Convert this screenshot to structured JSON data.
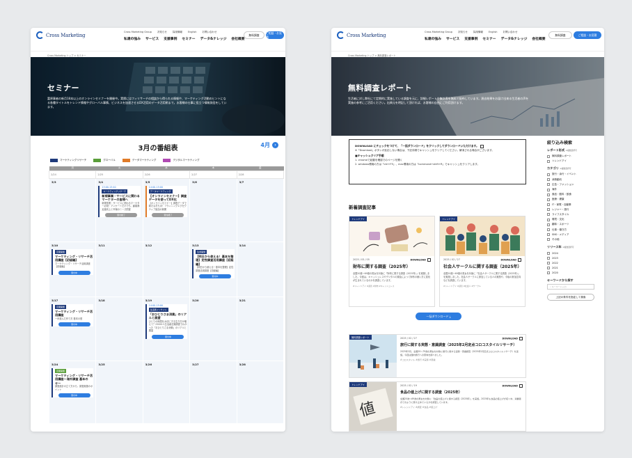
{
  "brand": {
    "logo": "Cross Marketing",
    "primary": "#2e7de0",
    "navy": "#1e3a7b"
  },
  "header": {
    "util": [
      "Cross Marketing Group",
      "お知らせ",
      "採用情報",
      "English",
      "お問い合わせ"
    ],
    "nav": [
      "私達の強み",
      "サービス",
      "支援事例",
      "セミナー",
      "データ&ナレッジ",
      "会社概要"
    ],
    "btn_free": "無料調査",
    "btn_contact": "ご相談・お見積"
  },
  "seminar": {
    "breadcrumb": "Cross Marketing トップ > セミナー",
    "hero_title": "セミナー",
    "hero_text": "富原事者の新月18本以上のオンラインセミナーを開催中。実際にはフィリサーチの相談から得られる情報や、マーケティング活動のヒントになる各種タイトルをトレンド情報やグローバル事情、ビジネスを加速させるDX活用のデータ活用術まで。お客様の仕事に役立つ情報発信をしています。",
    "month_title": "3月の番組表",
    "next_month": "4月",
    "legend": [
      {
        "label": "マーケティングリサーチ",
        "color": "#1e3a7b"
      },
      {
        "label": "グローバル",
        "color": "#5a9e3a"
      },
      {
        "label": "データマーケティング",
        "color": "#e07b28"
      },
      {
        "label": "デジタルマーケティング",
        "color": "#b04ab3"
      }
    ],
    "weekdays": [
      "月",
      "火",
      "水",
      "木",
      "金"
    ],
    "weeks": [
      {
        "labels": [
          "2/24",
          "2/25",
          "2/26",
          "2/27",
          "2/28"
        ],
        "days": [
          "3/3",
          "3/4",
          "3/5",
          "3/6",
          "3/7"
        ]
      },
      {
        "labels": [],
        "days": [
          "3/10",
          "3/11",
          "3/12",
          "3/13",
          "3/14"
        ]
      },
      {
        "labels": [],
        "days": [
          "3/17",
          "3/18",
          "3/19",
          "3/20",
          "3/21"
        ]
      },
      {
        "labels": [],
        "days": [
          "3/24",
          "3/25",
          "3/26",
          "3/27",
          "3/28"
        ]
      }
    ],
    "events": {
      "e1": {
        "time": "13:00-13:40",
        "tag": "マーケティングリサーチ",
        "title": "新規事業・サービスに関わるマーケターの皆様へ",
        "desc": "新規事業・サービスに関わるマーケター必見！アンケートだけでも、顧客満足度向上と市場のニーズ把握",
        "btn": "受付終了"
      },
      "e2": {
        "time": "14:00-15:00",
        "tag": "データマーケティング",
        "title": "【オンラインセミナー】調査データを使ってDX化",
        "desc": "【オンラインセミナー】調査データで新たな打ち手！プランニングエグゼクティブ追加の新開",
        "btn": "受付終了"
      },
      "e3": {
        "tag": "定期開催",
        "title": "マーケティング・リサーチ活用講座【初級編】",
        "desc": "マーケティング・リサーチ活用講座【初級編】",
        "btn": "受付中"
      },
      "e4": {
        "tag": "生成開催",
        "title": "【明日から使える！基本を整理】定性調査活用講座【初級編】",
        "desc": "【明日から使える！基本を整理】定性調査活用講座【初級編】",
        "btn": "受付中"
      },
      "e5": {
        "tag": "定期開催",
        "title": "マーケティング・リサーチ活用講座",
        "desc": "一歩進んだ作り方 基本の型",
        "btn": "受付中"
      },
      "e6": {
        "time": "14:00-15:00",
        "tag": "生活者インサイト",
        "title": "「おひとりさま消費」のリアルと展望",
        "desc": "ひとりの時間を大切にする生き方が増えて？25000人生活者意識調査でわかった「おひとりさま消費」のリアルと展望",
        "btn": "受付中"
      },
      "e7": {
        "tag": "定期開催",
        "title": "マーケティング・リサーチ活用講座〜海外調査 基本の キ〜",
        "desc": "調査設計の立て方から、調査実施のポイント",
        "btn": "受付中"
      }
    }
  },
  "report": {
    "breadcrumb": "Cross Marketing トップ > 無料調査レポート",
    "hero_title": "無料調査レポート",
    "hero_text": "生活者に対し弊社にて定期的に実施している調査を元に、詳細レポートや集計表を無料で配布しています。過去結果をお届け出来る生活者の声を実施の参考にご活用ください。出典元を明記して頂ければ、お客様の自由にご利用頂けます。",
    "notice_title": "DOWNLOAD にチェックをつけて、「一括ダウンロード」をクリックしてダウンロードいただけます。",
    "notice_note": "※「Download」ボタンが反応しない場合は、下記手順でキャッシュをクリアしてください。解消される場合がございます。",
    "cache_title": "■キャッシュクリア手順",
    "cache_steps": [
      "1. chromeで起動を確認でのページを開く",
      "2. windows環境の方は「ctrl+F5」、mac環境の方は「command+shift+R」でキャッシュをクリアします。"
    ],
    "new_title": "新着調査記事",
    "download_label": "DOWNLOAD",
    "bulk_btn": "一括ダウンロード",
    "cards": [
      {
        "cat": "トレンドアイ",
        "date": "2025 / 03 / 05",
        "title": "財布に関する調査（2025年）",
        "excerpt": "全国20歳〜69歳の男女を対象に「財布に関する調査（2025年）」を実施しました。今回は、キャッシュレスやデジタルの普及によって財布の使い方に変化が生まれているのかを調査しています。",
        "tags": "#トレンドアイ #調査 #財布 #キャッシュレス"
      },
      {
        "cat": "トレンドアイ",
        "date": "2025 / 02 / 27",
        "title": "社会人サークルに関する調査（2025年）",
        "excerpt": "全国20歳〜69歳の男女を対象に「社会人サークルに関する調査（2025年）」を実施しました。社会人サークルに参加している人の実態や、今後の参加意向などを調査しています。",
        "tags": "#トレンドアイ #調査 #社会人 #サークル"
      }
    ],
    "list": [
      {
        "cat": "無料調査レポート",
        "date": "2025 / 02 / 27",
        "title": "旅行に関する実態・意識調査（2025年2月定点コロコスタイルリサーチ）",
        "excerpt": "2025年2月、全国20〜79歳の男女を対象に旅行に関する実態・意識調査（2025年2月定点コロコスタイルリサーチ）を実施。今回は国内旅行への意向を調べました。",
        "tags": "#コロスタイル #旅行 #実態 #意識"
      },
      {
        "cat": "トレンドアイ",
        "date": "2025 / 02 / 19",
        "title": "食品の値上げに関する調査（2025年）",
        "excerpt": "全国20歳〜69歳の男女を対象に「食品の値上げに関する調査（2025年）」を実施。2025年も食品の値上げが続く中、消費者がどのように受け止めているかを調査しています。",
        "tags": "#トレンドアイ #調査 #食品 #値上げ"
      }
    ],
    "filter": {
      "title": "絞り込み検索",
      "type_title": "レポート形式",
      "type_sub": "※複数選択可",
      "types": [
        "無料調査レポート",
        "トレンドアイ"
      ],
      "cat_title": "カテゴリ",
      "cat_sub": "※複数選択可",
      "cats": [
        "旅行・余行・イベント",
        "消費動向",
        "広告・ファッション",
        "海外",
        "食品・飲料・飲食",
        "医療・健康",
        "IT・家電・自動車",
        "レジャー・旅行",
        "ライフスタイル",
        "環境・文化",
        "趣味・スポーツ",
        "仕事・働き方",
        "SNS・メディア",
        "その他"
      ],
      "year_title": "リリース年",
      "year_sub": "※複数選択可",
      "years": [
        "2024",
        "2023",
        "2022",
        "2021",
        "2020"
      ],
      "kw_title": "キーワードから探す",
      "kw_placeholder": "キーワード入力",
      "search_btn": "上記の条件を指定して検索"
    }
  }
}
